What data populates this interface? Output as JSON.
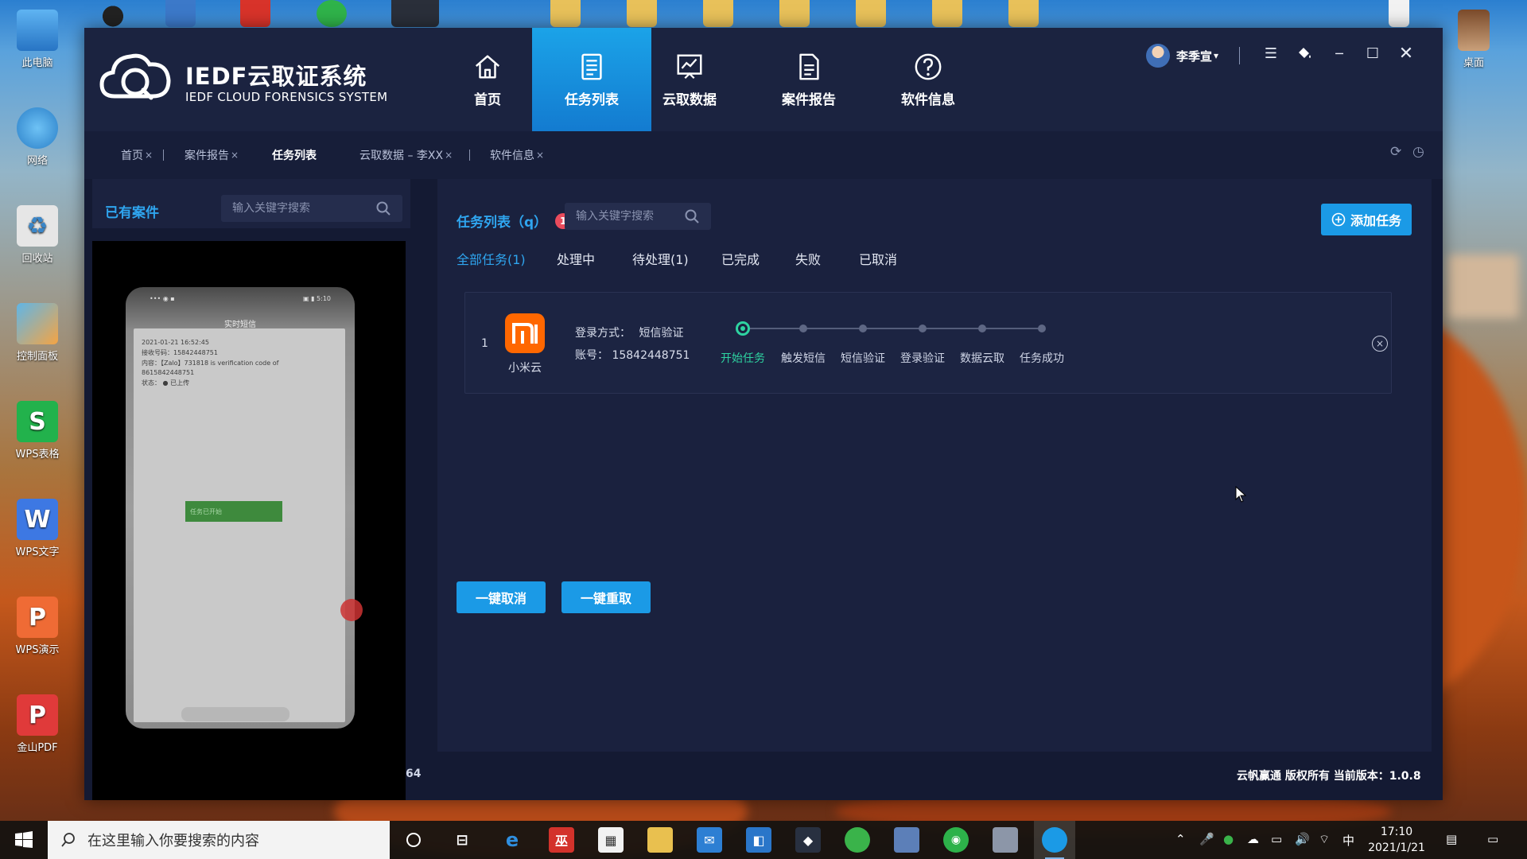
{
  "desktop": {
    "icons": [
      {
        "label": "此电脑",
        "icon": "computer-icon"
      },
      {
        "label": "网络",
        "icon": "network-icon"
      },
      {
        "label": "回收站",
        "icon": "recycle-bin-icon"
      },
      {
        "label": "控制面板",
        "icon": "control-panel-icon"
      },
      {
        "label": "WPS表格",
        "icon": "wps-spreadsheet-icon",
        "glyph": "S"
      },
      {
        "label": "WPS文字",
        "icon": "wps-writer-icon",
        "glyph": "W"
      },
      {
        "label": "WPS演示",
        "icon": "wps-presentation-icon",
        "glyph": "P"
      },
      {
        "label": "金山PDF",
        "icon": "kingsoft-pdf-icon",
        "glyph": "P"
      }
    ],
    "right_icon": {
      "label": "桌面",
      "icon": "desktop-folder-icon"
    }
  },
  "app": {
    "logo_title": "IEDF云取证系统",
    "logo_subtitle": "IEDF CLOUD FORENSICS SYSTEM",
    "nav": [
      {
        "label": "首页",
        "icon": "home-icon"
      },
      {
        "label": "任务列表",
        "icon": "task-list-icon",
        "active": true
      },
      {
        "label": "云取数据",
        "icon": "chart-icon"
      },
      {
        "label": "案件报告",
        "icon": "report-icon"
      },
      {
        "label": "软件信息",
        "icon": "help-icon"
      }
    ],
    "user_name": "李季宣",
    "user_caret": "▾",
    "window_controls": {
      "minimize": "─",
      "maximize": "☐",
      "close": "✕"
    },
    "tabs": [
      {
        "label": "首页",
        "close": "×"
      },
      {
        "label": "案件报告",
        "close": "×"
      },
      {
        "label": "任务列表",
        "close": "",
        "active": true
      },
      {
        "label": "云取数据 – 李XX",
        "close": "×"
      },
      {
        "label": "软件信息",
        "close": "×"
      }
    ],
    "left_panel": {
      "title": "已有案件",
      "search_placeholder": "输入关键字搜索"
    },
    "phone_mirror": {
      "status_left": "••• ◉ ▪",
      "status_right": "▣ ▮ 5:10",
      "app_title": "实时短信",
      "time": "2021-01-21 16:52:45",
      "number": "接收号码：15842448751",
      "content": "内容：【Zalo】731818 is verification code of 8615842448751",
      "status": "状态： ● 已上传",
      "button": "任务已开始"
    },
    "main_panel": {
      "title": "任务列表（q）",
      "badge_count": "1",
      "search_placeholder": "输入关键字搜索",
      "add_button": "添加任务",
      "filters": [
        {
          "label": "全部任务(1)",
          "active": true
        },
        {
          "label": "处理中"
        },
        {
          "label": "待处理(1)"
        },
        {
          "label": "已完成"
        },
        {
          "label": "失败"
        },
        {
          "label": "已取消"
        }
      ],
      "task": {
        "index": "1",
        "provider": "小米云",
        "login_method_label": "登录方式：",
        "login_method": "短信验证",
        "account_label": "账号：",
        "account": "15842448751",
        "steps": [
          {
            "label": "开始任务",
            "active": true
          },
          {
            "label": "触发短信"
          },
          {
            "label": "短信验证"
          },
          {
            "label": "登录验证"
          },
          {
            "label": "数据云取"
          },
          {
            "label": "任务成功"
          }
        ],
        "close": "×"
      },
      "cancel_all": "一键取消",
      "retry_all": "一键重取"
    },
    "footer_left": "64",
    "footer_right": "云帆赢通 版权所有 当前版本：1.0.8"
  },
  "taskbar": {
    "search_placeholder": "在这里输入你要搜索的内容",
    "ime": "中",
    "time": "17:10",
    "date": "2021/1/21"
  },
  "colors": {
    "accent": "#1b9ae6",
    "active_step": "#2ed3a1",
    "badge": "#ea4b5c",
    "app_bg": "#141a33"
  }
}
